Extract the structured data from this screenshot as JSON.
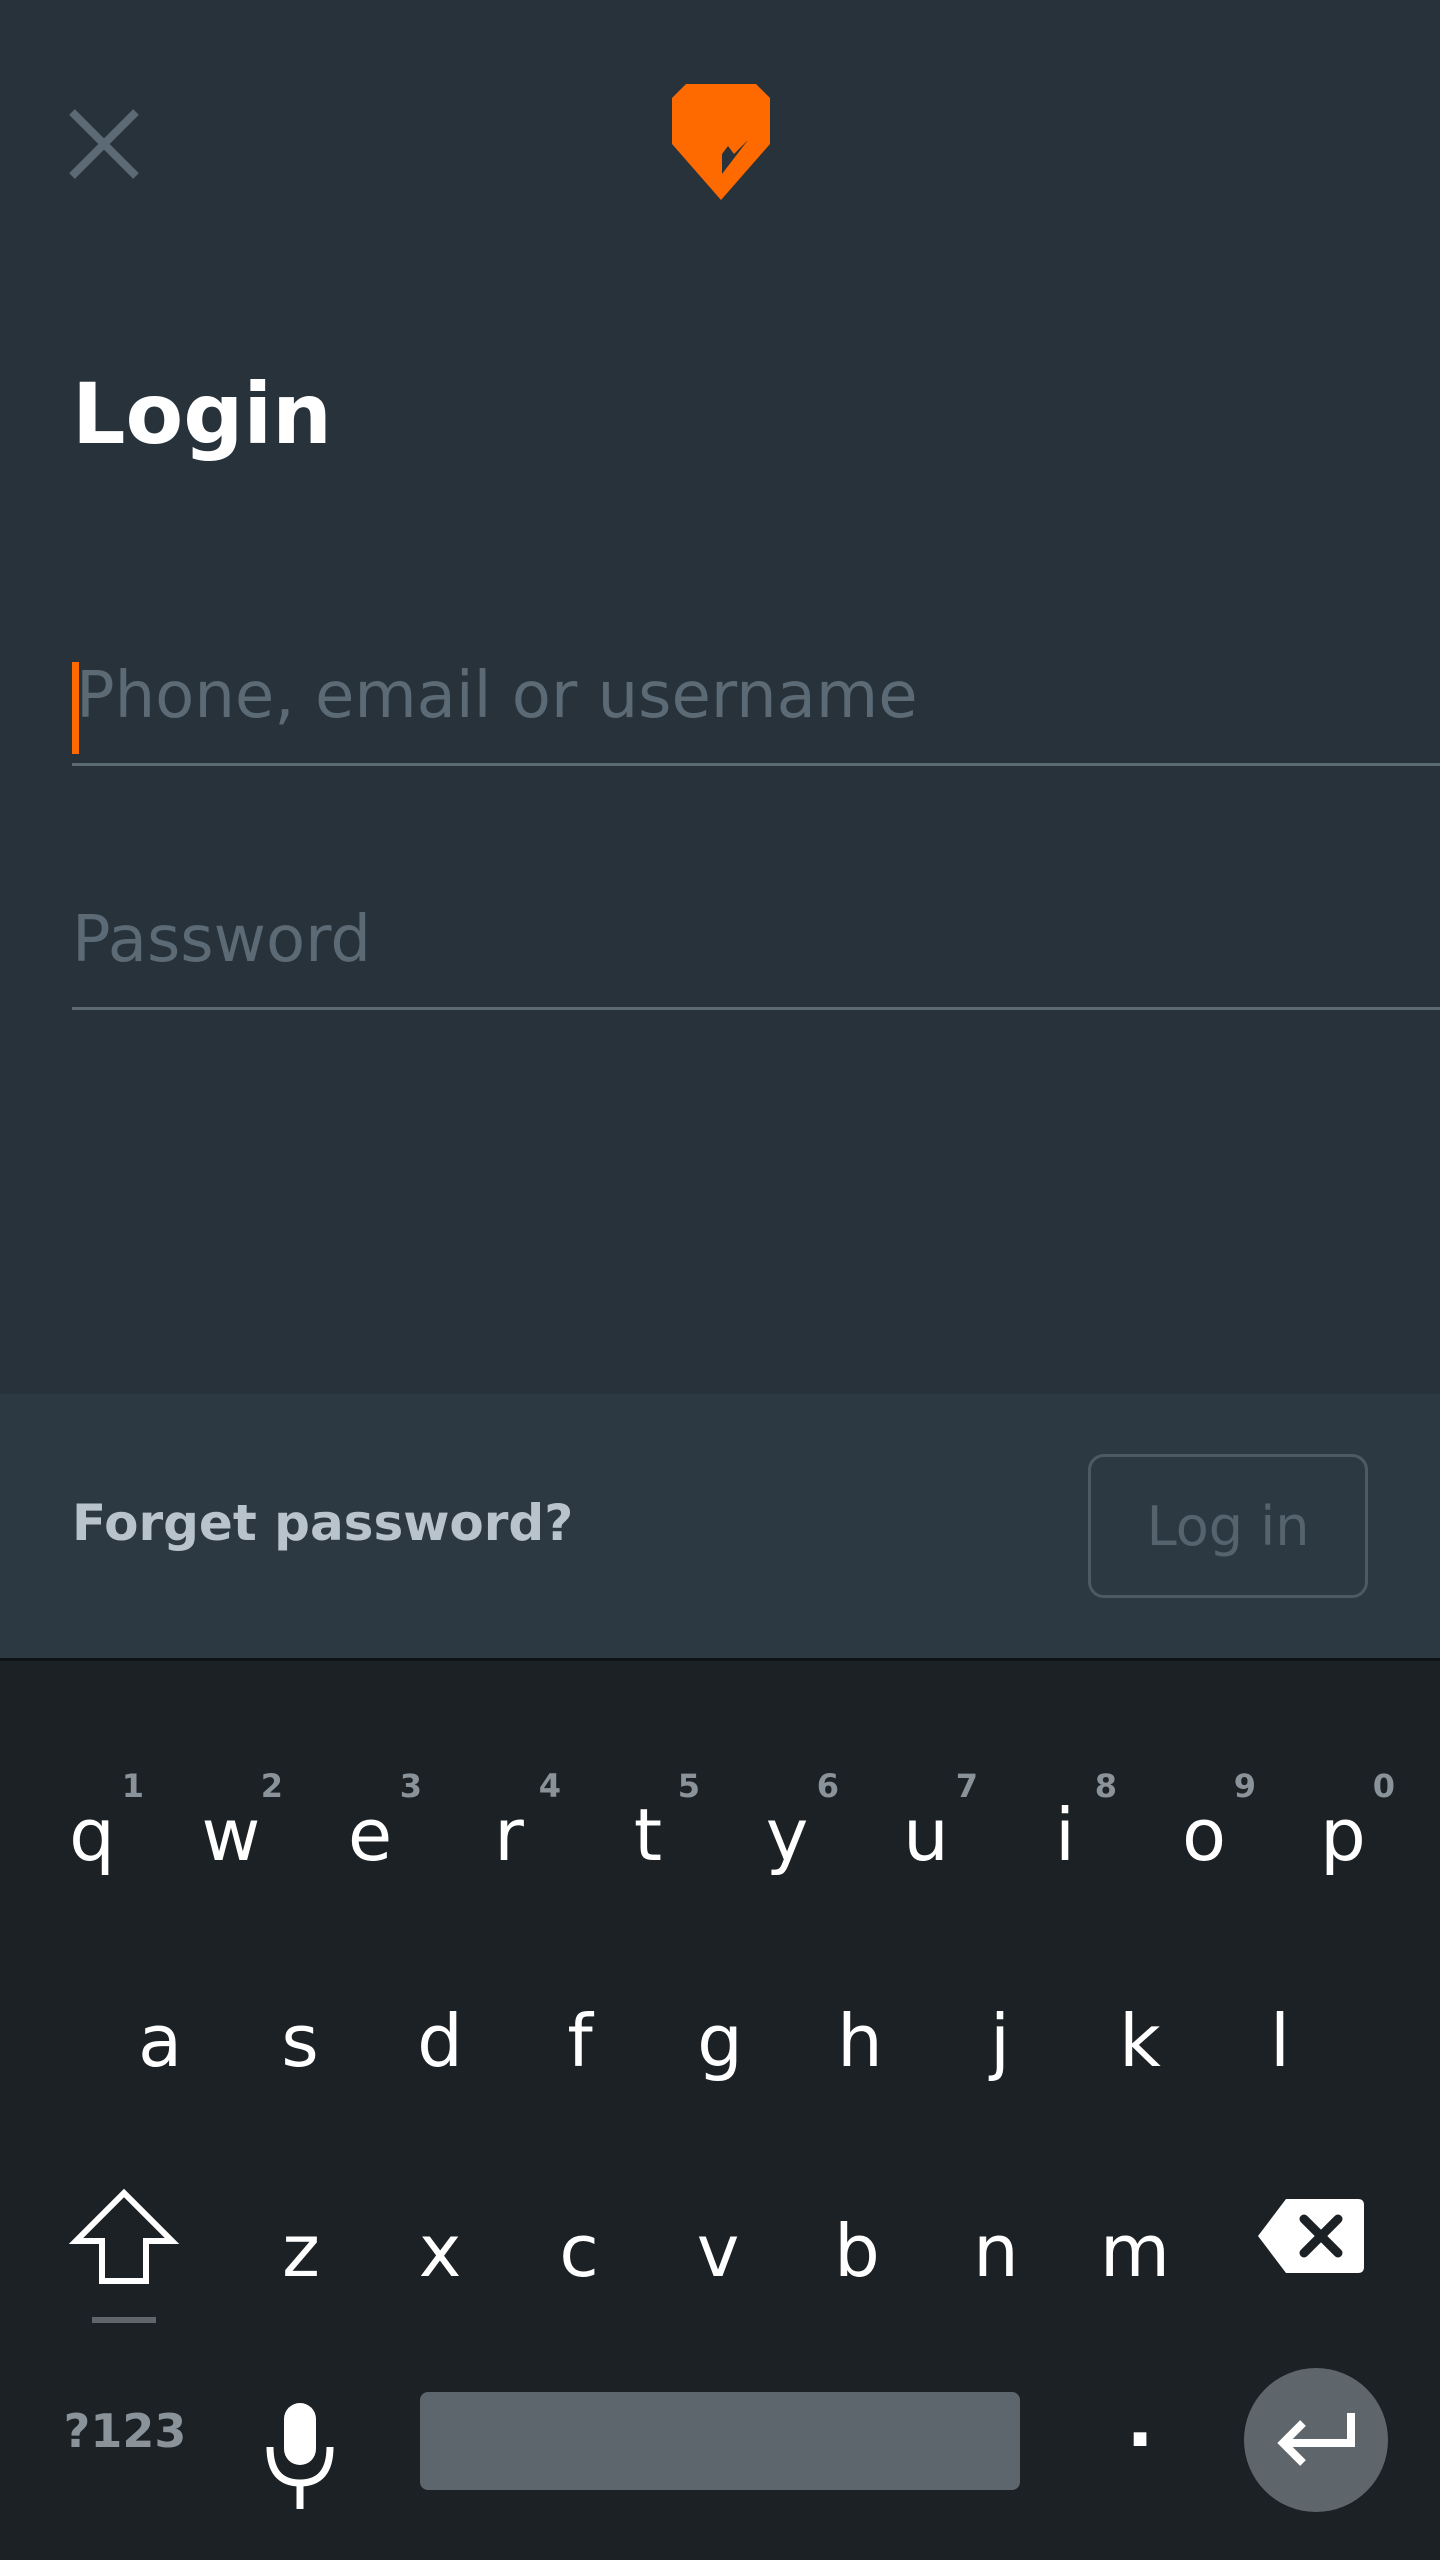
{
  "header": {
    "close_icon": "close-icon",
    "logo_icon": "brand-logo-icon"
  },
  "page": {
    "title": "Login"
  },
  "form": {
    "username_placeholder": "Phone, email or username",
    "username_value": "",
    "password_placeholder": "Password",
    "password_value": ""
  },
  "actions": {
    "forgot_password": "Forget password?",
    "login_label": "Log in"
  },
  "keyboard": {
    "row1": [
      {
        "char": "q",
        "hint": "1"
      },
      {
        "char": "w",
        "hint": "2"
      },
      {
        "char": "e",
        "hint": "3"
      },
      {
        "char": "r",
        "hint": "4"
      },
      {
        "char": "t",
        "hint": "5"
      },
      {
        "char": "y",
        "hint": "6"
      },
      {
        "char": "u",
        "hint": "7"
      },
      {
        "char": "i",
        "hint": "8"
      },
      {
        "char": "o",
        "hint": "9"
      },
      {
        "char": "p",
        "hint": "0"
      }
    ],
    "row2": [
      "a",
      "s",
      "d",
      "f",
      "g",
      "h",
      "j",
      "k",
      "l"
    ],
    "row3": [
      "z",
      "x",
      "c",
      "v",
      "b",
      "n",
      "m"
    ],
    "symbols_label": "?123",
    "period_label": ".",
    "shift_icon": "shift-icon",
    "delete_icon": "backspace-icon",
    "mic_icon": "microphone-icon",
    "enter_icon": "enter-icon"
  },
  "colors": {
    "background": "#27323a",
    "accent": "#ff6a00",
    "action_bar": "#2d3942",
    "keyboard": "#1b2125"
  }
}
